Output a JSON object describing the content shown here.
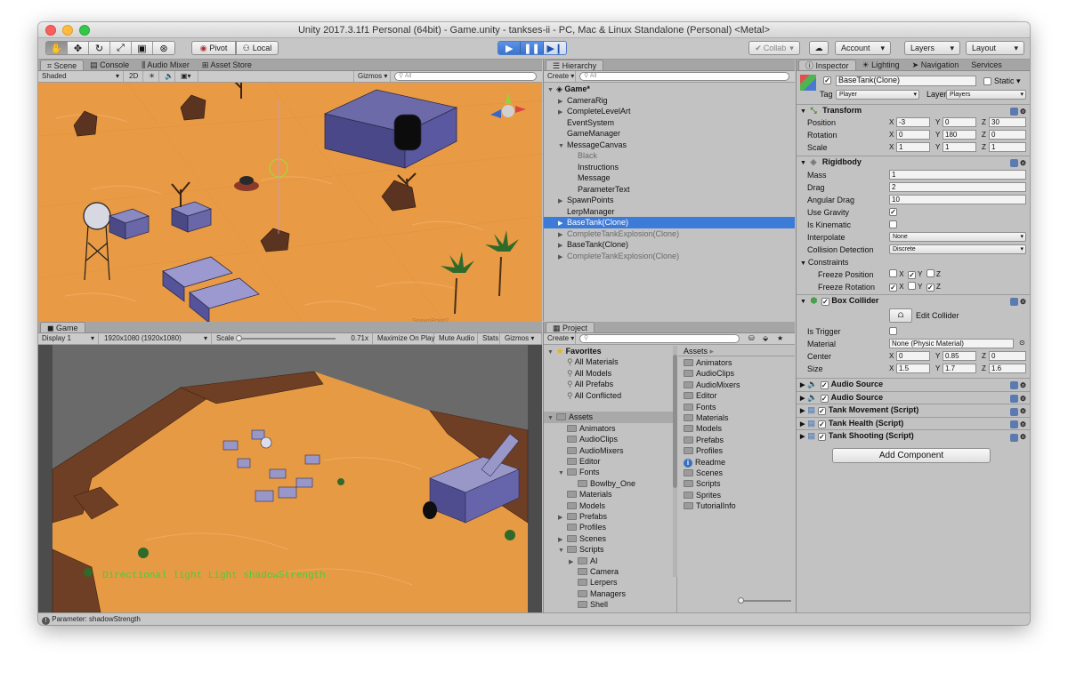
{
  "window": {
    "title": "Unity 2017.3.1f1 Personal (64bit) - Game.unity - tankses-ii - PC, Mac & Linux Standalone (Personal) <Metal>"
  },
  "toolbar": {
    "pivot": "Pivot",
    "local": "Local",
    "collab": "Collab",
    "account": "Account",
    "layers": "Layers",
    "layout": "Layout",
    "tool_icons": [
      "hand-icon",
      "move-icon",
      "rotate-icon",
      "scale-icon",
      "rect-icon",
      "transform-icon"
    ],
    "play_icons": [
      "play-icon",
      "pause-icon",
      "step-icon"
    ]
  },
  "scene": {
    "tabs": [
      "Scene",
      "Console",
      "Audio Mixer",
      "Asset Store"
    ],
    "shading": "Shaded",
    "mode_2d": "2D",
    "gizmos": "Gizmos",
    "search_placeholder": "All",
    "spawn_label": "SpawnPoint2"
  },
  "game": {
    "tab": "Game",
    "display": "Display 1",
    "resolution": "1920x1080 (1920x1080)",
    "scale_label": "Scale",
    "scale_value": "0.71x",
    "maximize": "Maximize On Play",
    "mute": "Mute Audio",
    "stats": "Stats",
    "gizmos": "Gizmos",
    "overlay": "Directional light Light shadowStrength"
  },
  "hierarchy": {
    "tab": "Hierarchy",
    "create": "Create",
    "search_placeholder": "All",
    "items": [
      {
        "label": "Game*",
        "level": 0,
        "tri": "▼",
        "sel": false,
        "gray": false,
        "bold": true
      },
      {
        "label": "CameraRig",
        "level": 1,
        "tri": "▶",
        "sel": false,
        "gray": false
      },
      {
        "label": "CompleteLevelArt",
        "level": 1,
        "tri": "▶",
        "sel": false,
        "gray": false
      },
      {
        "label": "EventSystem",
        "level": 1,
        "tri": "",
        "sel": false,
        "gray": false
      },
      {
        "label": "GameManager",
        "level": 1,
        "tri": "",
        "sel": false,
        "gray": false
      },
      {
        "label": "MessageCanvas",
        "level": 1,
        "tri": "▼",
        "sel": false,
        "gray": false
      },
      {
        "label": "Black",
        "level": 2,
        "tri": "",
        "sel": false,
        "gray": true
      },
      {
        "label": "Instructions",
        "level": 2,
        "tri": "",
        "sel": false,
        "gray": false
      },
      {
        "label": "Message",
        "level": 2,
        "tri": "",
        "sel": false,
        "gray": false
      },
      {
        "label": "ParameterText",
        "level": 2,
        "tri": "",
        "sel": false,
        "gray": false
      },
      {
        "label": "SpawnPoints",
        "level": 1,
        "tri": "▶",
        "sel": false,
        "gray": false
      },
      {
        "label": "LerpManager",
        "level": 1,
        "tri": "",
        "sel": false,
        "gray": false
      },
      {
        "label": "BaseTank(Clone)",
        "level": 1,
        "tri": "▶",
        "sel": true,
        "gray": false
      },
      {
        "label": "CompleteTankExplosion(Clone)",
        "level": 1,
        "tri": "▶",
        "sel": false,
        "gray": true
      },
      {
        "label": "BaseTank(Clone)",
        "level": 1,
        "tri": "▶",
        "sel": false,
        "gray": false
      },
      {
        "label": "CompleteTankExplosion(Clone)",
        "level": 1,
        "tri": "▶",
        "sel": false,
        "gray": true
      }
    ]
  },
  "project": {
    "tab": "Project",
    "create": "Create",
    "tree": [
      {
        "label": "Favorites",
        "level": 0,
        "tri": "▼",
        "icon": "star",
        "bold": true
      },
      {
        "label": "All Materials",
        "level": 1,
        "tri": "",
        "icon": "search"
      },
      {
        "label": "All Models",
        "level": 1,
        "tri": "",
        "icon": "search"
      },
      {
        "label": "All Prefabs",
        "level": 1,
        "tri": "",
        "icon": "search"
      },
      {
        "label": "All Conflicted",
        "level": 1,
        "tri": "",
        "icon": "search"
      },
      {
        "label": "",
        "level": 0,
        "tri": "",
        "icon": "none"
      },
      {
        "label": "Assets",
        "level": 0,
        "tri": "▼",
        "icon": "folder",
        "sel": true
      },
      {
        "label": "Animators",
        "level": 1,
        "tri": "",
        "icon": "folder"
      },
      {
        "label": "AudioClips",
        "level": 1,
        "tri": "",
        "icon": "folder"
      },
      {
        "label": "AudioMixers",
        "level": 1,
        "tri": "",
        "icon": "folder"
      },
      {
        "label": "Editor",
        "level": 1,
        "tri": "",
        "icon": "folder"
      },
      {
        "label": "Fonts",
        "level": 1,
        "tri": "▼",
        "icon": "folder"
      },
      {
        "label": "Bowlby_One",
        "level": 2,
        "tri": "",
        "icon": "folder"
      },
      {
        "label": "Materials",
        "level": 1,
        "tri": "",
        "icon": "folder"
      },
      {
        "label": "Models",
        "level": 1,
        "tri": "",
        "icon": "folder"
      },
      {
        "label": "Prefabs",
        "level": 1,
        "tri": "▶",
        "icon": "folder"
      },
      {
        "label": "Profiles",
        "level": 1,
        "tri": "",
        "icon": "folder"
      },
      {
        "label": "Scenes",
        "level": 1,
        "tri": "▶",
        "icon": "folder"
      },
      {
        "label": "Scripts",
        "level": 1,
        "tri": "▼",
        "icon": "folder"
      },
      {
        "label": "AI",
        "level": 2,
        "tri": "▶",
        "icon": "folder"
      },
      {
        "label": "Camera",
        "level": 2,
        "tri": "",
        "icon": "folder"
      },
      {
        "label": "Lerpers",
        "level": 2,
        "tri": "",
        "icon": "folder"
      },
      {
        "label": "Managers",
        "level": 2,
        "tri": "",
        "icon": "folder"
      },
      {
        "label": "Shell",
        "level": 2,
        "tri": "",
        "icon": "folder"
      }
    ],
    "breadcrumb": "Assets",
    "assets": [
      {
        "label": "Animators",
        "icon": "folder"
      },
      {
        "label": "AudioClips",
        "icon": "folder"
      },
      {
        "label": "AudioMixers",
        "icon": "folder"
      },
      {
        "label": "Editor",
        "icon": "folder"
      },
      {
        "label": "Fonts",
        "icon": "folder"
      },
      {
        "label": "Materials",
        "icon": "folder"
      },
      {
        "label": "Models",
        "icon": "folder"
      },
      {
        "label": "Prefabs",
        "icon": "folder"
      },
      {
        "label": "Profiles",
        "icon": "folder"
      },
      {
        "label": "Readme",
        "icon": "info"
      },
      {
        "label": "Scenes",
        "icon": "folder"
      },
      {
        "label": "Scripts",
        "icon": "folder"
      },
      {
        "label": "Sprites",
        "icon": "folder"
      },
      {
        "label": "TutorialInfo",
        "icon": "folder"
      }
    ]
  },
  "inspector": {
    "tabs": [
      "Inspector",
      "Lighting",
      "Navigation",
      "Services"
    ],
    "object_name": "BaseTank(Clone)",
    "static": "Static",
    "tag_label": "Tag",
    "tag_value": "Player",
    "layer_label": "Layer",
    "layer_value": "Players",
    "transform": {
      "title": "Transform",
      "position_label": "Position",
      "position": [
        "-3",
        "0",
        "30"
      ],
      "rotation_label": "Rotation",
      "rotation": [
        "0",
        "180",
        "0"
      ],
      "scale_label": "Scale",
      "scale": [
        "1",
        "1",
        "1"
      ]
    },
    "rigidbody": {
      "title": "Rigidbody",
      "mass_label": "Mass",
      "mass": "1",
      "drag_label": "Drag",
      "drag": "2",
      "angular_drag_label": "Angular Drag",
      "angular_drag": "10",
      "use_gravity_label": "Use Gravity",
      "use_gravity": true,
      "is_kinematic_label": "Is Kinematic",
      "is_kinematic": false,
      "interpolate_label": "Interpolate",
      "interpolate": "None",
      "collision_label": "Collision Detection",
      "collision": "Discrete",
      "constraints_label": "Constraints",
      "freeze_pos_label": "Freeze Position",
      "freeze_pos": [
        false,
        true,
        false
      ],
      "freeze_rot_label": "Freeze Rotation",
      "freeze_rot": [
        true,
        false,
        true
      ]
    },
    "box_collider": {
      "title": "Box Collider",
      "edit": "Edit Collider",
      "is_trigger_label": "Is Trigger",
      "is_trigger": false,
      "material_label": "Material",
      "material": "None (Physic Material)",
      "center_label": "Center",
      "center": [
        "0",
        "0.85",
        "0"
      ],
      "size_label": "Size",
      "size": [
        "1.5",
        "1.7",
        "1.6"
      ]
    },
    "scripts": [
      {
        "title": "Audio Source",
        "icon": "speaker-icon"
      },
      {
        "title": "Audio Source",
        "icon": "speaker-icon"
      },
      {
        "title": "Tank Movement (Script)",
        "icon": "script-icon"
      },
      {
        "title": "Tank Health (Script)",
        "icon": "script-icon"
      },
      {
        "title": "Tank Shooting (Script)",
        "icon": "script-icon"
      }
    ],
    "add_component": "Add Component"
  },
  "status": {
    "text": "Parameter: shadowStrength"
  }
}
